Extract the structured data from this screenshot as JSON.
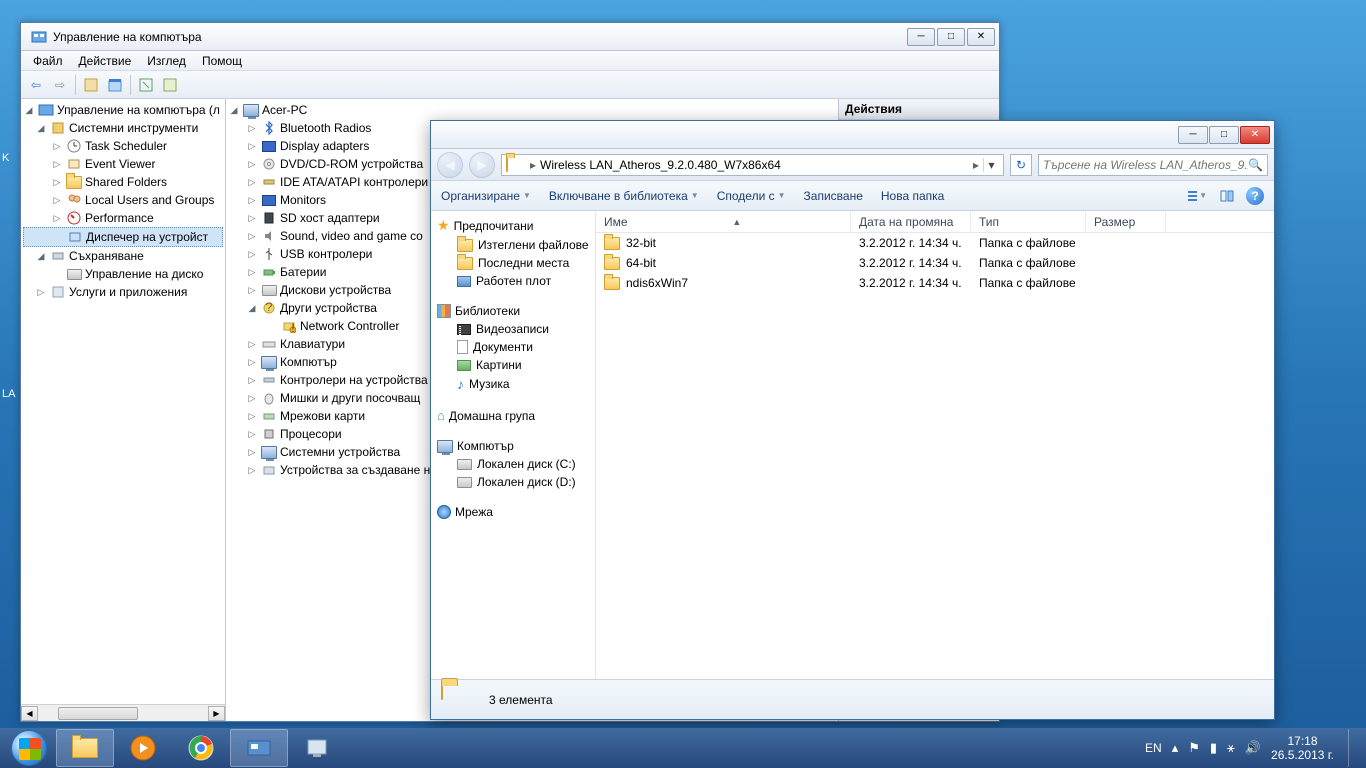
{
  "desktop": {
    "language_label": "LA"
  },
  "computer_management": {
    "title": "Управление на компютъра",
    "menu": [
      "Файл",
      "Действие",
      "Изглед",
      "Помощ"
    ],
    "left_tree": {
      "root": "Управление на компютъра (л",
      "system_tools": {
        "label": "Системни инструменти",
        "children": [
          "Task Scheduler",
          "Event Viewer",
          "Shared Folders",
          "Local Users and Groups",
          "Performance",
          "Диспечер на устройст"
        ]
      },
      "storage": {
        "label": "Съхраняване",
        "children": [
          "Управление на диско"
        ]
      },
      "services": {
        "label": "Услуги и приложения"
      }
    },
    "device_tree": {
      "root": "Acer-PC",
      "items": [
        "Bluetooth Radios",
        "Display adapters",
        "DVD/CD-ROM устройства",
        "IDE ATA/ATAPI контролери",
        "Monitors",
        "SD хост адаптери",
        "Sound, video and game co",
        "USB контролери",
        "Батерии",
        "Дискови устройства"
      ],
      "other_devices": {
        "label": "Други устройства",
        "child": "Network Controller"
      },
      "items2": [
        "Клавиатури",
        "Компютър",
        "Контролери на устройства",
        "Мишки и други посочващ",
        "Мрежови карти",
        "Процесори",
        "Системни устройства",
        "Устройства за създаване на"
      ]
    },
    "actions_header": "Действия"
  },
  "explorer": {
    "breadcrumb": "Wireless LAN_Atheros_9.2.0.480_W7x86x64",
    "search_placeholder": "Търсене на Wireless LAN_Atheros_9.2...",
    "toolbar": {
      "organize": "Организиране",
      "include": "Включване в библиотека",
      "share": "Сподели с",
      "burn": "Записване",
      "new_folder": "Нова папка"
    },
    "navpane": {
      "favorites": {
        "label": "Предпочитани",
        "items": [
          "Изтеглени файлове",
          "Последни места",
          "Работен плот"
        ]
      },
      "libraries": {
        "label": "Библиотеки",
        "items": [
          "Видеозаписи",
          "Документи",
          "Картини",
          "Музика"
        ]
      },
      "homegroup": "Домашна група",
      "computer": {
        "label": "Компютър",
        "items": [
          "Локален диск (C:)",
          "Локален диск (D:)"
        ]
      },
      "network": "Мрежа"
    },
    "columns": {
      "name": "Име",
      "date": "Дата на промяна",
      "type": "Тип",
      "size": "Размер"
    },
    "files": [
      {
        "name": "32-bit",
        "date": "3.2.2012 г. 14:34 ч.",
        "type": "Папка с файлове"
      },
      {
        "name": "64-bit",
        "date": "3.2.2012 г. 14:34 ч.",
        "type": "Папка с файлове"
      },
      {
        "name": "ndis6xWin7",
        "date": "3.2.2012 г. 14:34 ч.",
        "type": "Папка с файлове"
      }
    ],
    "status": "3 елемента"
  },
  "taskbar": {
    "lang": "EN",
    "time": "17:18",
    "date": "26.5.2013 г."
  }
}
